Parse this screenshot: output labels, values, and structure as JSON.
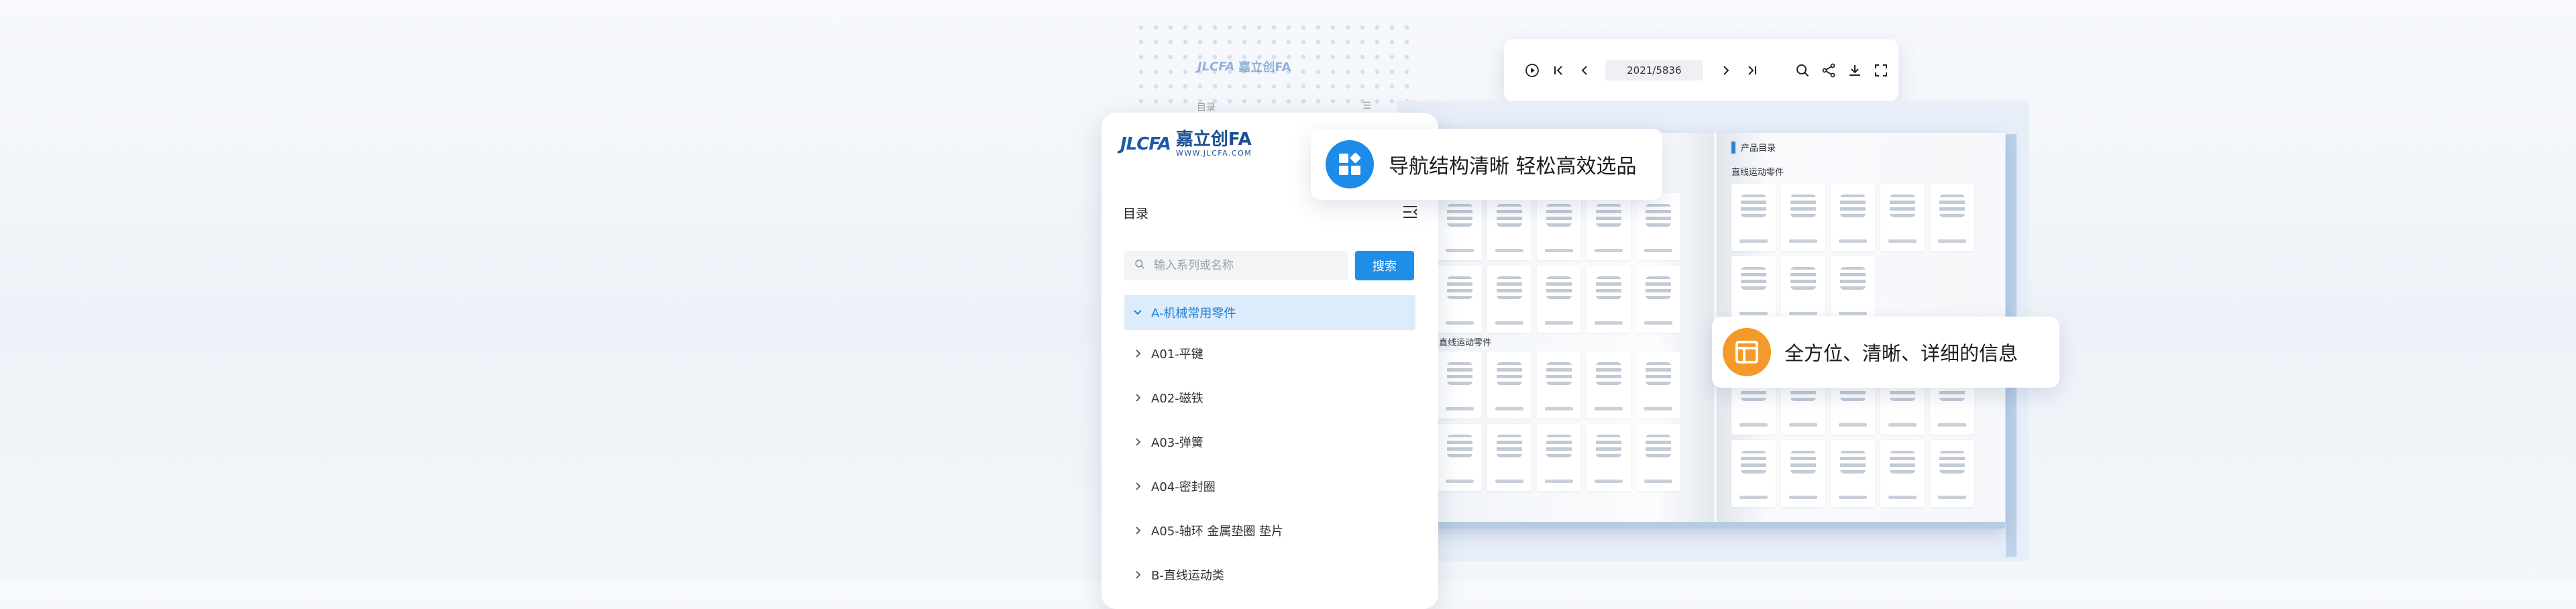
{
  "brand": {
    "logo_mark": "JLCFA",
    "name_cn": "嘉立创FA",
    "url": "WWW.JLCFA.COM"
  },
  "toolbar": {
    "page_value": "2021/5836",
    "icons": [
      "play-icon",
      "first-page-icon",
      "prev-page-icon",
      "next-page-icon",
      "last-page-icon",
      "search-icon",
      "share-icon",
      "download-icon",
      "fullscreen-icon"
    ]
  },
  "sidebar": {
    "toc_title": "目录",
    "search_placeholder": "输入系列或名称",
    "search_button": "搜索",
    "items": [
      {
        "label": "A-机械常用零件",
        "expanded": true
      },
      {
        "label": "A01-平键"
      },
      {
        "label": "A02-磁铁"
      },
      {
        "label": "A03-弹簧"
      },
      {
        "label": "A04-密封圈"
      },
      {
        "label": "A05-轴环 金属垫圈 垫片"
      },
      {
        "label": "B-直线运动类"
      }
    ]
  },
  "callouts": {
    "navigation": "导航结构清晰 轻松高效选品",
    "info": "全方位、清晰、详细的信息"
  },
  "book": {
    "right_page_heading": "产品目录",
    "right_section_label": "直线运动零件",
    "left_section_label": "直线运动零件"
  },
  "colors": {
    "accent": "#1e8ee8",
    "orange": "#f39a2b",
    "active_bg": "#dcecfb"
  }
}
